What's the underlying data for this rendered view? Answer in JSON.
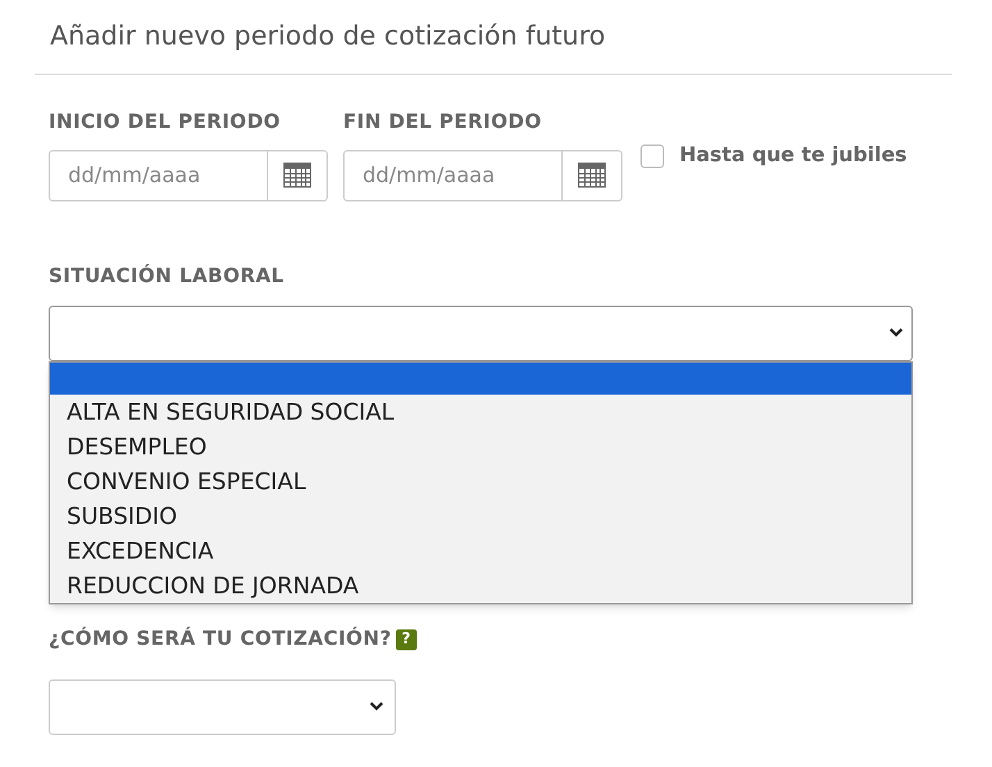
{
  "title": "Añadir nuevo periodo de cotización futuro",
  "period_start": {
    "label": "INICIO DEL PERIODO",
    "placeholder": "dd/mm/aaaa"
  },
  "period_end": {
    "label": "FIN DEL PERIODO",
    "placeholder": "dd/mm/aaaa"
  },
  "until_retirement": {
    "label": "Hasta que te jubiles",
    "checked": false
  },
  "employment_status": {
    "label": "SITUACIÓN LABORAL",
    "expanded": true,
    "blank_option_selected": true,
    "options": [
      {
        "label": "ALTA EN SEGURIDAD SOCIAL",
        "selected": false
      },
      {
        "label": "DESEMPLEO",
        "selected": false
      },
      {
        "label": "CONVENIO ESPECIAL",
        "selected": false
      },
      {
        "label": "SUBSIDIO",
        "selected": false
      },
      {
        "label": "EXCEDENCIA",
        "selected": false
      },
      {
        "label": "REDUCCION DE JORNADA",
        "selected": false
      }
    ]
  },
  "contribution": {
    "label": "¿CÓMO SERÁ TU COTIZACIÓN?",
    "help": "?"
  }
}
